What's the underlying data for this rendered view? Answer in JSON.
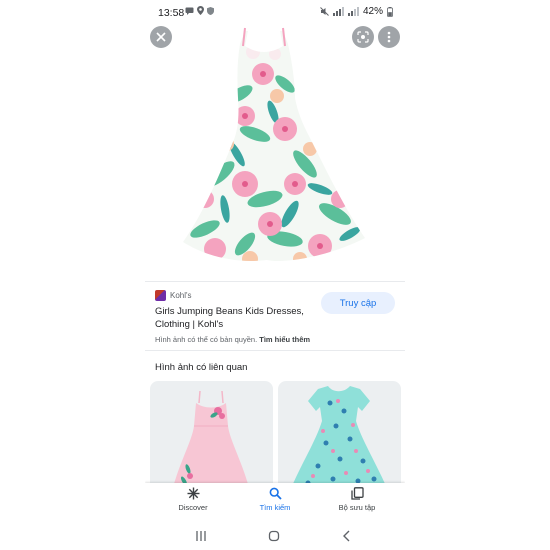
{
  "status_bar": {
    "time": "13:58",
    "battery": "42%"
  },
  "result": {
    "source_name": "Kohl's",
    "title": "Girls Jumping Beans Kids Dresses, Clothing | Kohl's",
    "visit_label": "Truy cập",
    "copyright_text": "Hình ảnh có thể có bản quyền.",
    "learn_more": "Tìm hiểu thêm"
  },
  "related": {
    "heading": "Hình ảnh có liên quan"
  },
  "bottom_nav": {
    "items": [
      {
        "label": "Discover",
        "icon": "asterisk-icon"
      },
      {
        "label": "Tìm kiếm",
        "icon": "search-icon",
        "active": true
      },
      {
        "label": "Bộ sưu tập",
        "icon": "collections-icon"
      }
    ]
  },
  "colors": {
    "accent": "#1a73e8",
    "visit_bg": "#e8f0fe"
  }
}
